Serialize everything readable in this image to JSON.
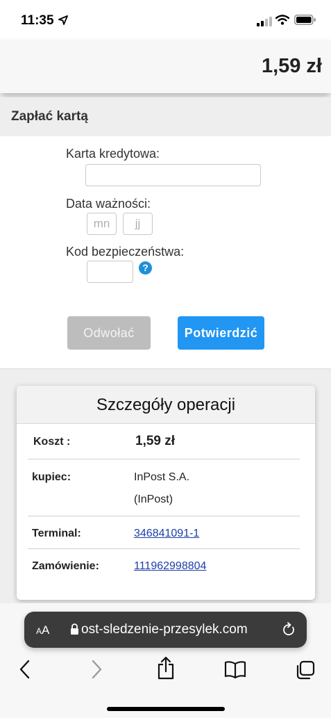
{
  "status": {
    "time": "11:35"
  },
  "header": {
    "amount": "1,59 zł"
  },
  "payment": {
    "title": "Zapłać kartą",
    "card_label": "Karta kredytowa:",
    "card_value": "",
    "expiry_label": "Data ważności:",
    "month_placeholder": "mn",
    "day_placeholder": "jj",
    "cvv_label": "Kod bezpieczeństwa:",
    "cvv_value": "",
    "help_symbol": "?",
    "cancel_label": "Odwołać",
    "confirm_label": "Potwierdzić"
  },
  "details": {
    "title": "Szczegóły operacji",
    "rows": [
      {
        "key": "Koszt :",
        "value": "1,59 zł"
      },
      {
        "key": "kupiec:",
        "value": "InPost S.A.",
        "value2": "(InPost)"
      },
      {
        "key": "Terminal:",
        "value": "346841091-1"
      },
      {
        "key": "Zamówienie:",
        "value": "111962998804"
      }
    ]
  },
  "browser": {
    "aa_label_small": "A",
    "aa_label_big": "A",
    "url": "ost-sledzenie-przesylek.com"
  },
  "colors": {
    "confirm": "#2196f3",
    "cancel": "#bdbdbd",
    "link": "#1a3ea8",
    "help": "#1e8fd8"
  }
}
